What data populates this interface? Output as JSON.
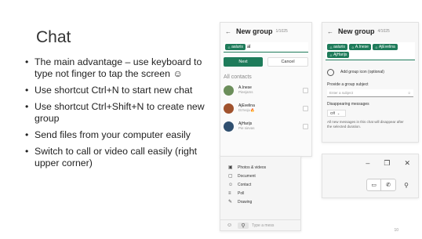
{
  "slide": {
    "title": "Chat",
    "bullets": [
      "The main advantage – use keyboard to type not finger to tap the screen ☺",
      "Use shortcut Ctrl+N to start new chat",
      "Use shortcut Ctrl+Shift+N to create new group",
      "Send files from your computer easily",
      "Switch to call or video call easily (right upper corner)"
    ],
    "page_number": "10"
  },
  "panel_new_group_search": {
    "back_icon": "back-arrow-icon",
    "title": "New group",
    "count": "1/1025",
    "chip": "aaluris",
    "typed": "al",
    "next_label": "Next",
    "cancel_label": "Cancel",
    "section_label": "All contacts",
    "contacts": [
      {
        "name": "A.Inese",
        "status": "Pieejams",
        "color": "#6b8e5a"
      },
      {
        "name": "AjEvelina",
        "status": "Dzīvoju🔥",
        "color": "#a0522d"
      },
      {
        "name": "AjHarijs",
        "status": "Pie sievas",
        "color": "#2f4f6f"
      }
    ]
  },
  "panel_new_group_details": {
    "back_icon": "back-arrow-icon",
    "title": "New group",
    "count": "4/1025",
    "chips": [
      "aaluris",
      "A.Inese",
      "AjEvelina",
      "AjHarijs"
    ],
    "add_icon_label": "Add group icon (optional)",
    "subject_label": "Provide a group subject",
    "subject_placeholder": "Enter a subject",
    "disappearing_label": "Disappearing messages",
    "disappearing_value": "Off",
    "note": "All new messages in this chat will disappear after the selected duration."
  },
  "panel_attach": {
    "items": [
      {
        "icon": "image-icon",
        "glyph": "▣",
        "label": "Photos & videos"
      },
      {
        "icon": "document-icon",
        "glyph": "▢",
        "label": "Document"
      },
      {
        "icon": "contact-icon",
        "glyph": "☺",
        "label": "Contact"
      },
      {
        "icon": "poll-icon",
        "glyph": "≡",
        "label": "Poll"
      },
      {
        "icon": "drawing-icon",
        "glyph": "✎",
        "label": "Drawing"
      }
    ],
    "compose_placeholder": "Type a mess"
  },
  "panel_window": {
    "minimize": "–",
    "maximize": "❐",
    "close": "✕",
    "video_icon": "▭",
    "call_icon": "✆",
    "search_icon": "⚲"
  }
}
